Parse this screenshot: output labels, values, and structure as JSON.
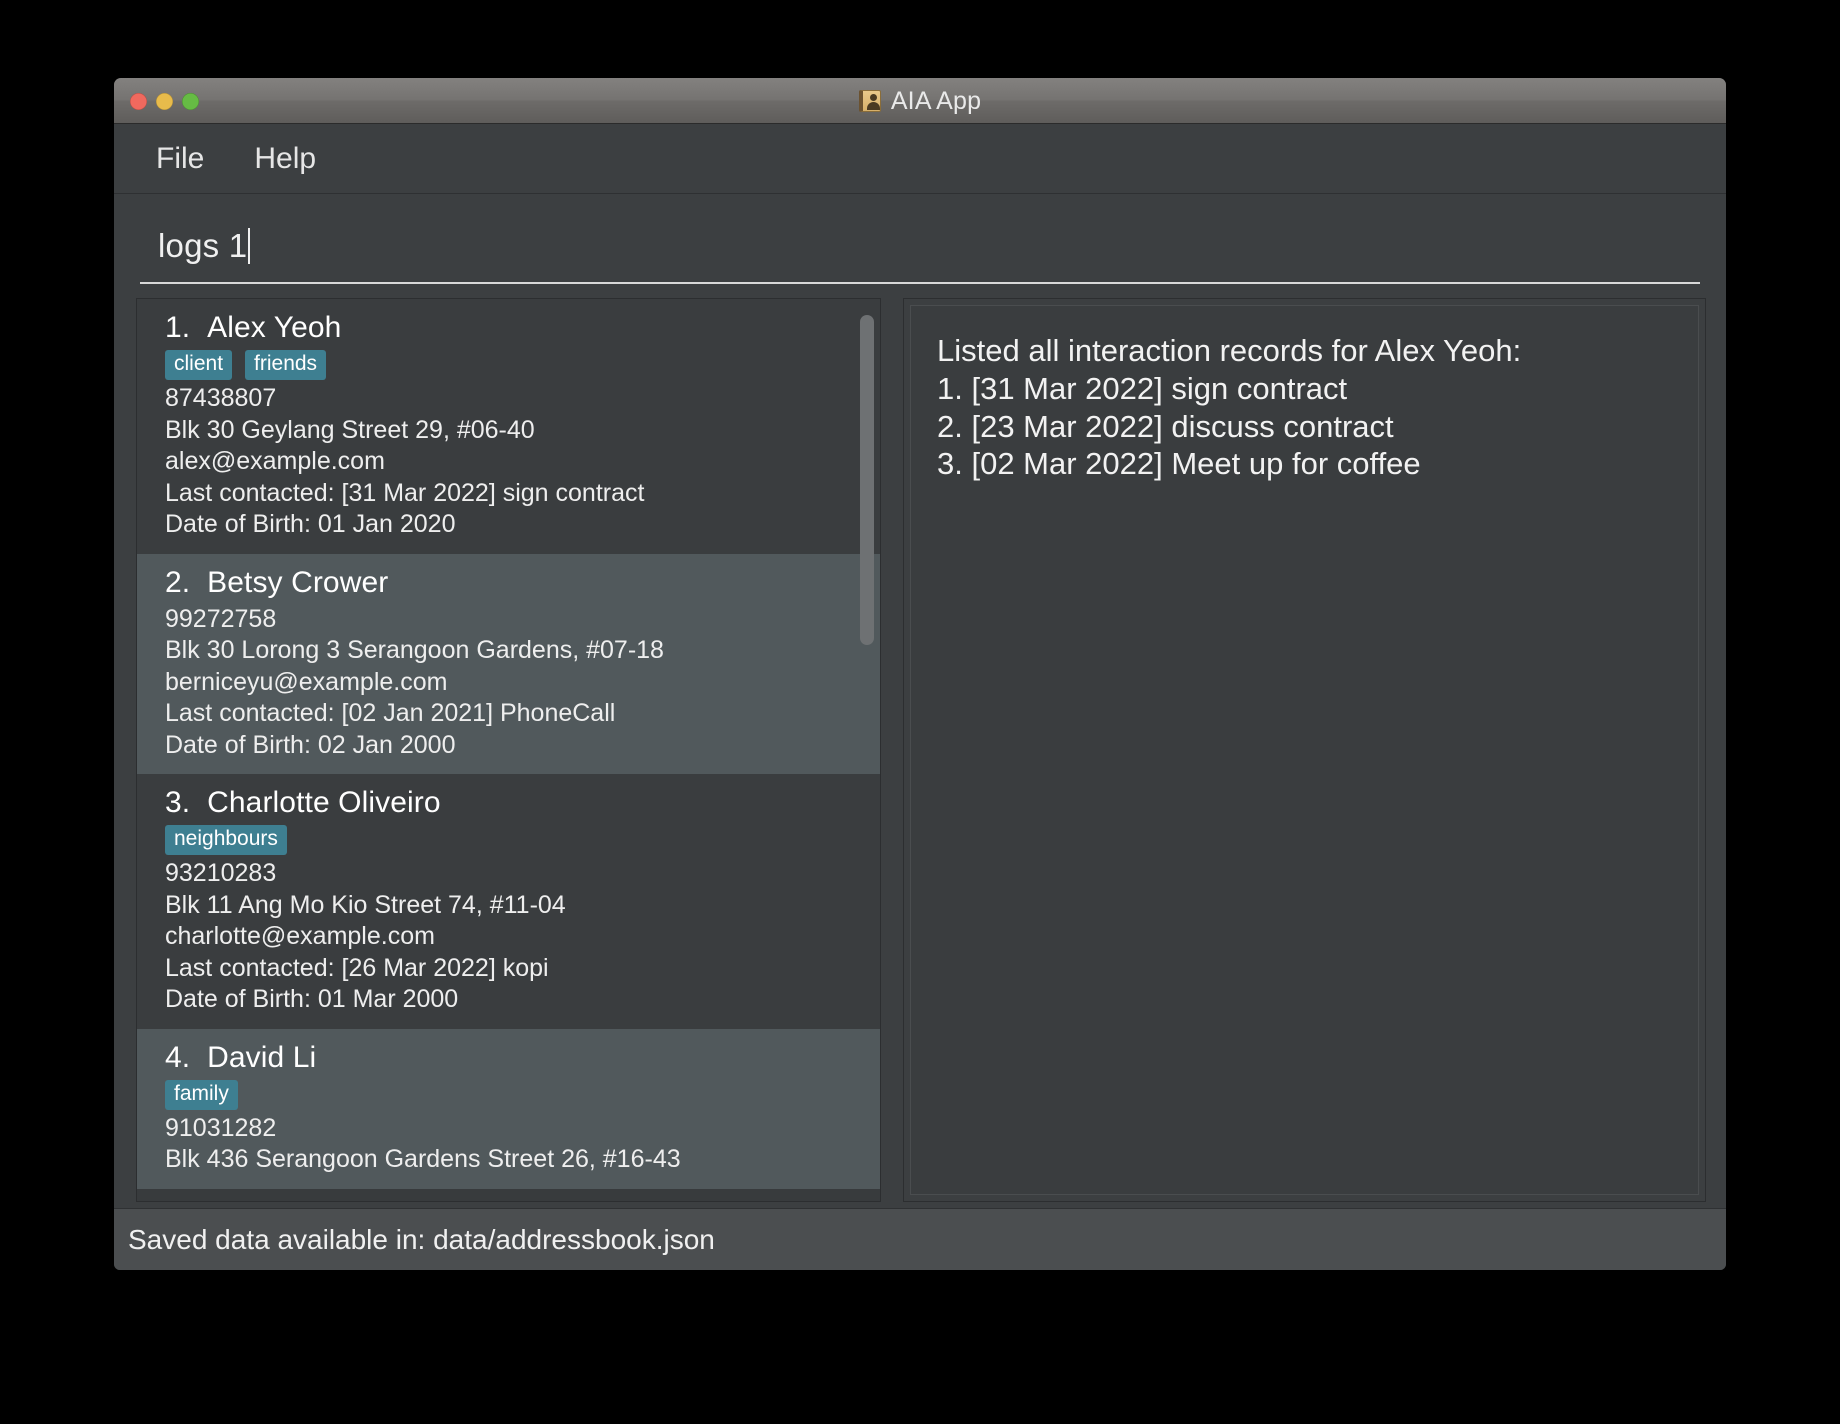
{
  "window": {
    "title": "AIA App",
    "icon": "address-book-icon",
    "traffic_lights": [
      {
        "name": "close",
        "color": "#f0695e"
      },
      {
        "name": "minimize",
        "color": "#e8bb4b"
      },
      {
        "name": "maximize",
        "color": "#66bb44"
      }
    ]
  },
  "menubar": {
    "items": [
      {
        "label": "File",
        "name": "menu-file"
      },
      {
        "label": "Help",
        "name": "menu-help"
      }
    ]
  },
  "command_box": {
    "value": "logs 1",
    "placeholder": "Enter command here...",
    "caret_visible": true
  },
  "person_list": {
    "persons": [
      {
        "index": "1.",
        "name": "Alex Yeoh",
        "tags": [
          "client",
          "friends"
        ],
        "phone": "87438807",
        "address": "Blk 30 Geylang Street 29, #06-40",
        "email": "alex@example.com",
        "last_contacted": "Last contacted: [31 Mar 2022] sign contract",
        "date_of_birth": "Date of Birth: 01 Jan 2020",
        "selected": false
      },
      {
        "index": "2.",
        "name": "Betsy Crower",
        "tags": [],
        "phone": "99272758",
        "address": "Blk 30 Lorong 3 Serangoon Gardens, #07-18",
        "email": "berniceyu@example.com",
        "last_contacted": "Last contacted: [02 Jan 2021] PhoneCall",
        "date_of_birth": "Date of Birth: 02 Jan 2000",
        "selected": true
      },
      {
        "index": "3.",
        "name": "Charlotte Oliveiro",
        "tags": [
          "neighbours"
        ],
        "phone": "93210283",
        "address": "Blk 11 Ang Mo Kio Street 74, #11-04",
        "email": "charlotte@example.com",
        "last_contacted": "Last contacted: [26 Mar 2022] kopi",
        "date_of_birth": "Date of Birth: 01 Mar 2000",
        "selected": false
      },
      {
        "index": "4.",
        "name": "David Li",
        "tags": [
          "family"
        ],
        "phone": "91031282",
        "address": "Blk 436 Serangoon Gardens Street 26, #16-43",
        "email": "",
        "last_contacted": "",
        "date_of_birth": "",
        "selected": true
      }
    ],
    "scrollbar": {
      "name": "list-scrollbar"
    }
  },
  "result_display": {
    "lines": [
      "Listed all interaction records for Alex Yeoh:",
      "1. [31 Mar 2022] sign contract",
      "2. [23 Mar 2022] discuss contract",
      "3. [02 Mar 2022] Meet up for coffee"
    ]
  },
  "status_bar": {
    "text": "Saved data available in: data/addressbook.json"
  },
  "colors": {
    "window_bg": "#3c3f41",
    "card_bg": "#3a3d3f",
    "card_selected_bg": "#51595c",
    "tag_bg": "#3e7f91",
    "text": "#f0f0f0",
    "status_bar_bg": "#4b4e50"
  }
}
